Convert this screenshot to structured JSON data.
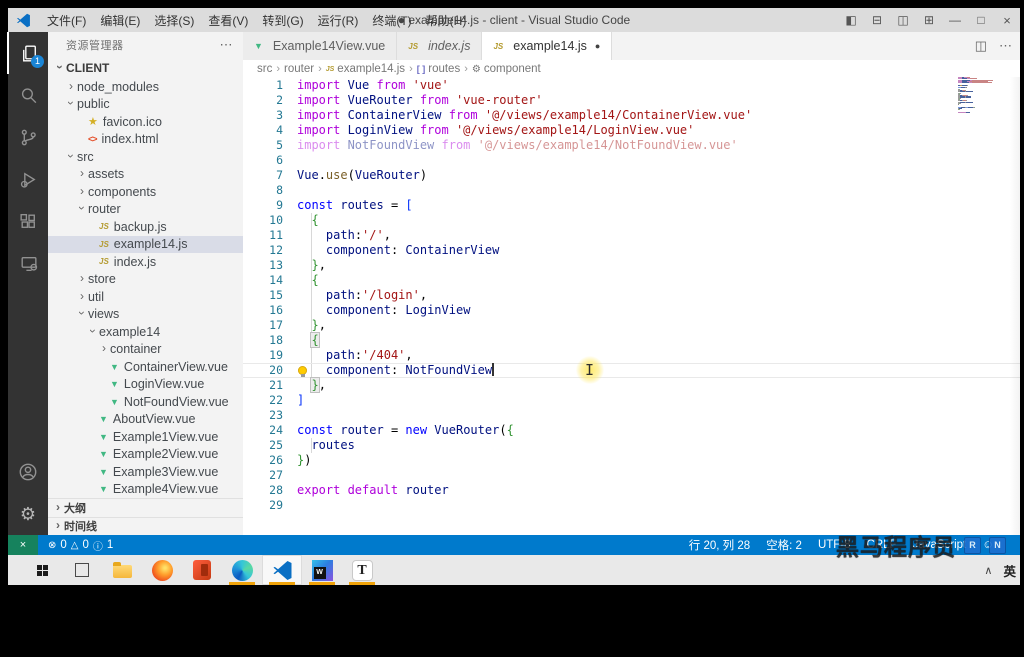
{
  "colors": {
    "status_bar": "#007acc",
    "remote_indicator": "#16825d",
    "activity_bar": "#333333",
    "sidebar": "#f3f3f3",
    "selection_row": "#d9dce7",
    "taskbar_underline": "#f0a30a",
    "accent_badge": "#1a85d6"
  },
  "titlebar": {
    "title": "● example14.js - client - Visual Studio Code",
    "menus": [
      "文件(F)",
      "编辑(E)",
      "选择(S)",
      "查看(V)",
      "转到(G)",
      "运行(R)",
      "终端(T)",
      "帮助(H)"
    ],
    "window_icons": {
      "layout_left": "◧",
      "layout_bottom": "⊟",
      "layout_split": "◫",
      "layout_custom": "⊞",
      "minimize": "—",
      "maximize": "□",
      "close": "×"
    }
  },
  "activity_bar": {
    "explorer_badge": "1"
  },
  "explorer": {
    "title": "资源管理器",
    "more": "⋯",
    "root": {
      "label": "CLIENT"
    },
    "items": [
      {
        "label": "node_modules",
        "level": 1,
        "chevron": "collapsed"
      },
      {
        "label": "public",
        "level": 1,
        "chevron": "expanded"
      },
      {
        "label": "favicon.ico",
        "level": 2,
        "icon": "star"
      },
      {
        "label": "index.html",
        "level": 2,
        "icon": "html"
      },
      {
        "label": "src",
        "level": 1,
        "chevron": "expanded"
      },
      {
        "label": "assets",
        "level": 2,
        "chevron": "collapsed"
      },
      {
        "label": "components",
        "level": 2,
        "chevron": "collapsed"
      },
      {
        "label": "router",
        "level": 2,
        "chevron": "expanded"
      },
      {
        "label": "backup.js",
        "level": 3,
        "icon": "js"
      },
      {
        "label": "example14.js",
        "level": 3,
        "icon": "js",
        "selected": true
      },
      {
        "label": "index.js",
        "level": 3,
        "icon": "js"
      },
      {
        "label": "store",
        "level": 2,
        "chevron": "collapsed"
      },
      {
        "label": "util",
        "level": 2,
        "chevron": "collapsed"
      },
      {
        "label": "views",
        "level": 2,
        "chevron": "expanded"
      },
      {
        "label": "example14",
        "level": 3,
        "chevron": "expanded"
      },
      {
        "label": "container",
        "level": 4,
        "chevron": "collapsed"
      },
      {
        "label": "ContainerView.vue",
        "level": 4,
        "icon": "vue"
      },
      {
        "label": "LoginView.vue",
        "level": 4,
        "icon": "vue"
      },
      {
        "label": "NotFoundView.vue",
        "level": 4,
        "icon": "vue"
      },
      {
        "label": "AboutView.vue",
        "level": 3,
        "icon": "vue"
      },
      {
        "label": "Example1View.vue",
        "level": 3,
        "icon": "vue"
      },
      {
        "label": "Example2View.vue",
        "level": 3,
        "icon": "vue"
      },
      {
        "label": "Example3View.vue",
        "level": 3,
        "icon": "vue"
      },
      {
        "label": "Example4View.vue",
        "level": 3,
        "icon": "vue"
      }
    ],
    "panels": [
      "大纲",
      "时间线"
    ]
  },
  "tabs": [
    {
      "label": "Example14View.vue",
      "icon": "vue"
    },
    {
      "label": "index.js",
      "icon": "js",
      "preview": true
    },
    {
      "label": "example14.js",
      "icon": "js",
      "active": true,
      "modified": true,
      "dot": "●"
    }
  ],
  "tab_bar_icons": {
    "split": "◫",
    "more": "⋯"
  },
  "breadcrumbs": [
    {
      "label": "src"
    },
    {
      "label": "router"
    },
    {
      "label": "example14.js",
      "icon": "js"
    },
    {
      "label": "routes",
      "icon": "array"
    },
    {
      "label": "component",
      "icon": "wrench"
    }
  ],
  "editor": {
    "cursor_line": 20,
    "lightbulb_line": 20,
    "lines": [
      {
        "n": 1,
        "t": [
          [
            "k1",
            "import "
          ],
          [
            "id",
            "Vue "
          ],
          [
            "k1",
            "from "
          ],
          [
            "s",
            "'vue'"
          ]
        ]
      },
      {
        "n": 2,
        "t": [
          [
            "k1",
            "import "
          ],
          [
            "id",
            "VueRouter "
          ],
          [
            "k1",
            "from "
          ],
          [
            "s",
            "'vue-router'"
          ]
        ]
      },
      {
        "n": 3,
        "t": [
          [
            "k1",
            "import "
          ],
          [
            "id",
            "ContainerView "
          ],
          [
            "k1",
            "from "
          ],
          [
            "s",
            "'@/views/example14/ContainerView.vue'"
          ]
        ]
      },
      {
        "n": 4,
        "t": [
          [
            "k1",
            "import "
          ],
          [
            "id",
            "LoginView "
          ],
          [
            "k1",
            "from "
          ],
          [
            "s",
            "'@/views/example14/LoginView.vue'"
          ]
        ]
      },
      {
        "n": 5,
        "cls": "faded",
        "t": [
          [
            "k1",
            "import "
          ],
          [
            "id",
            "NotFoundView "
          ],
          [
            "k1",
            "from "
          ],
          [
            "s",
            "'@/views/example14/NotFoundView.vue'"
          ]
        ]
      },
      {
        "n": 6,
        "t": []
      },
      {
        "n": 7,
        "t": [
          [
            "id",
            "Vue"
          ],
          [
            "p",
            "."
          ],
          [
            "fn",
            "use"
          ],
          [
            "p",
            "("
          ],
          [
            "id",
            "VueRouter"
          ],
          [
            "p",
            ")"
          ]
        ]
      },
      {
        "n": 8,
        "t": []
      },
      {
        "n": 9,
        "t": [
          [
            "k2",
            "const "
          ],
          [
            "id",
            "routes "
          ],
          [
            "p",
            "= "
          ],
          [
            "b1",
            "["
          ]
        ]
      },
      {
        "n": 10,
        "t": [
          [
            "p",
            "  "
          ],
          [
            "b2",
            "{"
          ]
        ]
      },
      {
        "n": 11,
        "t": [
          [
            "p",
            "    "
          ],
          [
            "id",
            "path"
          ],
          [
            "p",
            ":"
          ],
          [
            "s",
            "'/'"
          ],
          [
            "p",
            ","
          ]
        ]
      },
      {
        "n": 12,
        "t": [
          [
            "p",
            "    "
          ],
          [
            "id",
            "component"
          ],
          [
            "p",
            ": "
          ],
          [
            "id",
            "ContainerView"
          ]
        ]
      },
      {
        "n": 13,
        "t": [
          [
            "p",
            "  "
          ],
          [
            "b2",
            "}"
          ],
          [
            "p",
            ","
          ]
        ]
      },
      {
        "n": 14,
        "t": [
          [
            "p",
            "  "
          ],
          [
            "b2",
            "{"
          ]
        ]
      },
      {
        "n": 15,
        "t": [
          [
            "p",
            "    "
          ],
          [
            "id",
            "path"
          ],
          [
            "p",
            ":"
          ],
          [
            "s",
            "'/login'"
          ],
          [
            "p",
            ","
          ]
        ]
      },
      {
        "n": 16,
        "t": [
          [
            "p",
            "    "
          ],
          [
            "id",
            "component"
          ],
          [
            "p",
            ": "
          ],
          [
            "id",
            "LoginView"
          ]
        ]
      },
      {
        "n": 17,
        "t": [
          [
            "p",
            "  "
          ],
          [
            "b2",
            "}"
          ],
          [
            "p",
            ","
          ]
        ]
      },
      {
        "n": 18,
        "t": [
          [
            "p",
            "  "
          ],
          [
            "b2 bm",
            "{"
          ]
        ]
      },
      {
        "n": 19,
        "t": [
          [
            "p",
            "    "
          ],
          [
            "id",
            "path"
          ],
          [
            "p",
            ":"
          ],
          [
            "s",
            "'/404'"
          ],
          [
            "p",
            ","
          ]
        ]
      },
      {
        "n": 20,
        "t": [
          [
            "p",
            "    "
          ],
          [
            "id",
            "component"
          ],
          [
            "p",
            ": "
          ],
          [
            "id",
            "NotFoundView"
          ]
        ]
      },
      {
        "n": 21,
        "t": [
          [
            "p",
            "  "
          ],
          [
            "b2 bm",
            "}"
          ],
          [
            "p",
            ","
          ]
        ]
      },
      {
        "n": 22,
        "t": [
          [
            "b1",
            "]"
          ]
        ]
      },
      {
        "n": 23,
        "t": []
      },
      {
        "n": 24,
        "t": [
          [
            "k2",
            "const "
          ],
          [
            "id",
            "router "
          ],
          [
            "p",
            "= "
          ],
          [
            "k2",
            "new "
          ],
          [
            "id",
            "VueRouter"
          ],
          [
            "p",
            "("
          ],
          [
            "b2",
            "{"
          ]
        ]
      },
      {
        "n": 25,
        "t": [
          [
            "p",
            "  "
          ],
          [
            "id",
            "routes"
          ]
        ]
      },
      {
        "n": 26,
        "t": [
          [
            "b2",
            "}"
          ],
          [
            "p",
            ")"
          ]
        ]
      },
      {
        "n": 27,
        "t": []
      },
      {
        "n": 28,
        "t": [
          [
            "k1",
            "export "
          ],
          [
            "k1",
            "default "
          ],
          [
            "id",
            "router"
          ]
        ]
      },
      {
        "n": 29,
        "t": []
      }
    ]
  },
  "status_bar": {
    "remote_icon": "×",
    "problems": {
      "error_icon": "⊗",
      "errors": "0",
      "warning_icon": "△",
      "warnings": "0",
      "info_icon": "ⓘ",
      "infos": "1"
    },
    "right": [
      "行 20, 列 28",
      "空格: 2",
      "UTF-8",
      "CRLF",
      "JavaScript",
      "☺"
    ]
  },
  "taskbar": {
    "apps": [
      {
        "name": "start"
      },
      {
        "name": "task-view"
      },
      {
        "name": "file-explorer"
      },
      {
        "name": "firefox"
      },
      {
        "name": "office"
      },
      {
        "name": "edge",
        "running": true
      },
      {
        "name": "vscode",
        "running": true,
        "active": true
      },
      {
        "name": "webstorm",
        "running": true,
        "ws_label": "W"
      },
      {
        "name": "typora",
        "running": true,
        "t_label": "T"
      }
    ],
    "tray": {
      "chevron": "∧",
      "ime": "英"
    }
  },
  "watermark": {
    "text": "黑马程序员",
    "badges": [
      "R",
      "N"
    ]
  }
}
